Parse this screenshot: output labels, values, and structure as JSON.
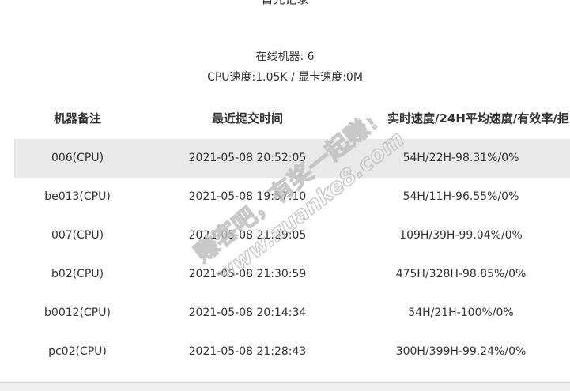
{
  "header": {
    "cut_title": "首先记录"
  },
  "summary": {
    "online_label": "在线机器: 6",
    "speed_label": "CPU速度:1.05K / 显卡速度:0M"
  },
  "table": {
    "columns": [
      "机器备注",
      "最近提交时间",
      "实时速度/24H平均速度/有效率/拒"
    ],
    "rows": [
      {
        "name": "006(CPU)",
        "time": "2021-05-08 20:52:05",
        "speed": "54H/22H-98.31%/0%"
      },
      {
        "name": "be013(CPU)",
        "time": "2021-05-08 19:57:10",
        "speed": "54H/11H-96.55%/0%"
      },
      {
        "name": "007(CPU)",
        "time": "2021-05-08 21:29:05",
        "speed": "109H/39H-99.04%/0%"
      },
      {
        "name": "b02(CPU)",
        "time": "2021-05-08 21:30:59",
        "speed": "475H/328H-98.85%/0%"
      },
      {
        "name": "b0012(CPU)",
        "time": "2021-05-08 20:14:34",
        "speed": "54H/21H-100%/0%"
      },
      {
        "name": "pc02(CPU)",
        "time": "2021-05-08 21:28:43",
        "speed": "300H/399H-99.24%/0%"
      }
    ]
  },
  "watermark": {
    "line1": "赚客吧，有奖一起赚！",
    "line2": "www.zuanke8.com",
    "color": "#bfbfbf"
  }
}
